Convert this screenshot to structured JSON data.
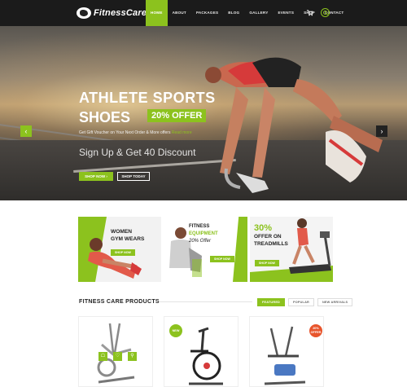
{
  "header": {
    "logo_text": "FitnessCare",
    "nav": [
      "HOME",
      "ABOUT",
      "PACKAGES",
      "BLOG",
      "GALLERY",
      "EVENTS",
      "SHOP",
      "CONTACT"
    ],
    "active_nav": "HOME",
    "icons": [
      "cart-icon",
      "search-icon"
    ]
  },
  "hero": {
    "title_line1": "ATHLETE SPORTS",
    "title_line2": "SHOES",
    "offer": "20% OFFER",
    "subtitle": "Get Gift Voucher on Your Next Order & More offers",
    "subtitle_link": "Read more",
    "discount": "Sign Up & Get 40 Discount",
    "btn_primary": "SHOP NOW  ›",
    "btn_secondary": "SHOP TODAY",
    "prev": "‹",
    "next": "›"
  },
  "promos": [
    {
      "title1": "WOMEN",
      "title2": "GYM WEARS",
      "button": "SHOP NOW"
    },
    {
      "title1": "FITNESS",
      "title2": "EQUIPMENT",
      "title3": "20% Offer",
      "button": "SHOP NOW"
    },
    {
      "title1": "30%",
      "title2": "OFFER ON",
      "title3": "TREADMILLS",
      "button": "SHOP NOW"
    }
  ],
  "products_section": {
    "title": "FITNESS CARE  PRODUCTS",
    "tabs": [
      "FEATURED",
      "POPULAR",
      "NEW ARRIVALS"
    ],
    "active_tab": "FEATURED"
  },
  "products": [
    {
      "badge": ""
    },
    {
      "badge": "NEW"
    },
    {
      "badge": "20% OFFER"
    }
  ],
  "colors": {
    "accent": "#8cc21e",
    "header_bg": "#1b1b1b",
    "sale": "#e8552c"
  }
}
